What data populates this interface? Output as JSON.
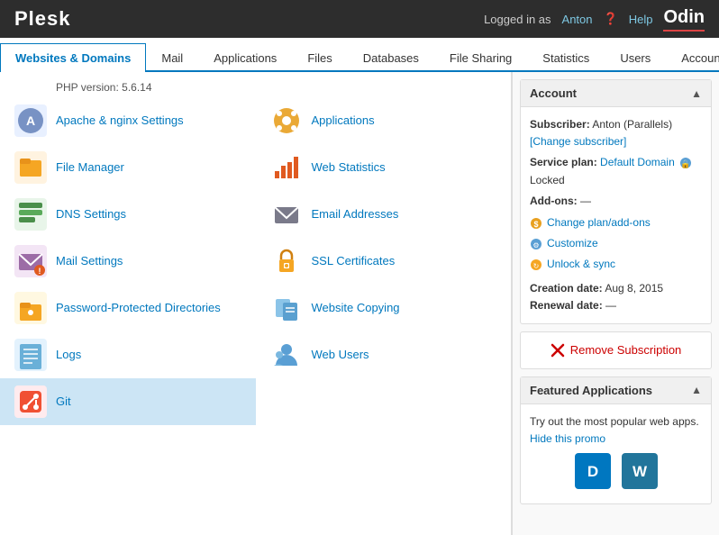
{
  "topbar": {
    "logo": "Plesk",
    "logged_in_as": "Logged in as",
    "username": "Anton",
    "help_label": "Help",
    "odin_logo": "Odin"
  },
  "nav": {
    "tabs": [
      {
        "id": "websites-domains",
        "label": "Websites & Domains",
        "active": true
      },
      {
        "id": "mail",
        "label": "Mail",
        "active": false
      },
      {
        "id": "applications",
        "label": "Applications",
        "active": false
      },
      {
        "id": "files",
        "label": "Files",
        "active": false
      },
      {
        "id": "databases",
        "label": "Databases",
        "active": false
      },
      {
        "id": "file-sharing",
        "label": "File Sharing",
        "active": false
      },
      {
        "id": "statistics",
        "label": "Statistics",
        "active": false
      },
      {
        "id": "users",
        "label": "Users",
        "active": false
      },
      {
        "id": "account",
        "label": "Account",
        "active": false
      }
    ]
  },
  "content": {
    "php_version_label": "PHP version: 5.6.14",
    "grid_items": [
      {
        "id": "apache-nginx",
        "label": "Apache & nginx Settings",
        "col": 0
      },
      {
        "id": "applications",
        "label": "Applications",
        "col": 1
      },
      {
        "id": "file-manager",
        "label": "File Manager",
        "col": 0
      },
      {
        "id": "web-statistics",
        "label": "Web Statistics",
        "col": 1
      },
      {
        "id": "dns-settings",
        "label": "DNS Settings",
        "col": 0
      },
      {
        "id": "email-addresses",
        "label": "Email Addresses",
        "col": 1
      },
      {
        "id": "mail-settings",
        "label": "Mail Settings",
        "col": 0
      },
      {
        "id": "ssl-certificates",
        "label": "SSL Certificates",
        "col": 1
      },
      {
        "id": "password-directories",
        "label": "Password-Protected Directories",
        "col": 0
      },
      {
        "id": "website-copying",
        "label": "Website Copying",
        "col": 1
      },
      {
        "id": "logs",
        "label": "Logs",
        "col": 0
      },
      {
        "id": "web-users",
        "label": "Web Users",
        "col": 1
      },
      {
        "id": "git",
        "label": "Git",
        "col": 0
      }
    ]
  },
  "sidebar": {
    "account_section": {
      "title": "Account",
      "subscriber_label": "Subscriber:",
      "subscriber_value": "Anton (Parallels)",
      "change_subscriber_label": "[Change subscriber]",
      "service_plan_label": "Service plan:",
      "service_plan_value": "Default Domain",
      "locked_label": "Locked",
      "add_ons_label": "Add-ons:",
      "add_ons_value": "—",
      "change_plan_label": "Change plan/add-ons",
      "customize_label": "Customize",
      "unlock_sync_label": "Unlock & sync",
      "creation_date_label": "Creation date:",
      "creation_date_value": "Aug 8, 2015",
      "renewal_date_label": "Renewal date:",
      "renewal_date_value": "—"
    },
    "remove_subscription_label": "Remove Subscription",
    "featured_apps_section": {
      "title": "Featured Applications",
      "description": "Try out the most popular web apps.",
      "hide_promo_label": "Hide this promo"
    }
  }
}
